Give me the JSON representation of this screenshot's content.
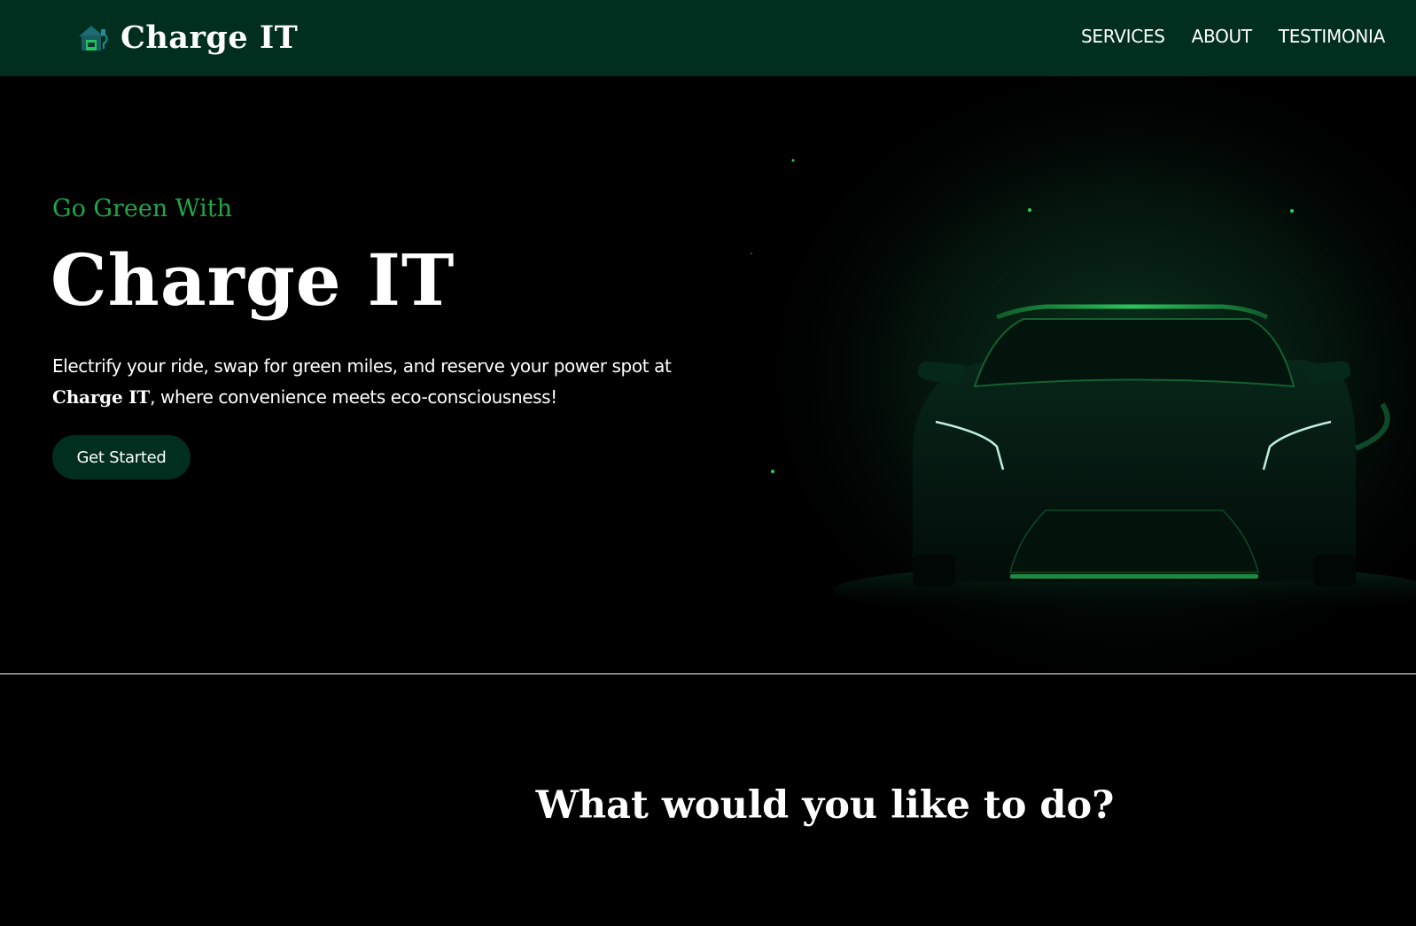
{
  "navbar": {
    "brand_name": "Charge IT",
    "logo_icon": "house-ev-charger-icon",
    "links": [
      "SERVICES",
      "ABOUT",
      "TESTIMONIA"
    ]
  },
  "hero": {
    "subtitle": "Go Green With",
    "title": "Charge IT",
    "description_line1": "Electrify your ride, swap for green miles, and reserve your power spot at",
    "description_brand": "Charge IT",
    "description_line2": ", where convenience meets eco-consciousness!",
    "cta_label": "Get Started",
    "image_icon": "electric-car-icon"
  },
  "services_section": {
    "title": "What would you like to do?"
  },
  "colors": {
    "navbar_bg": "#002e1f",
    "accent_green": "#21a64a",
    "page_bg": "#000000",
    "button_bg": "#002e1f"
  }
}
